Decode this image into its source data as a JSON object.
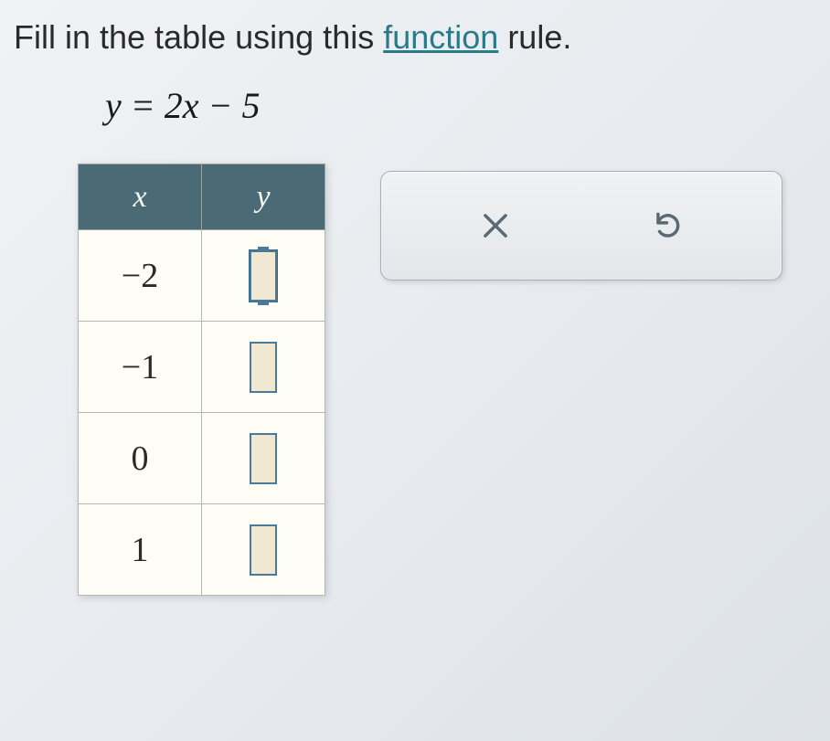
{
  "instruction": {
    "prefix": "Fill in the table using this ",
    "link": "function",
    "suffix": " rule."
  },
  "equation": "y = 2x − 5",
  "table": {
    "headers": {
      "x": "x",
      "y": "y"
    },
    "rows": [
      {
        "x": "−2",
        "y": ""
      },
      {
        "x": "−1",
        "y": ""
      },
      {
        "x": "0",
        "y": ""
      },
      {
        "x": "1",
        "y": ""
      }
    ]
  },
  "toolbar": {
    "clear": "×",
    "reset": "↺"
  }
}
